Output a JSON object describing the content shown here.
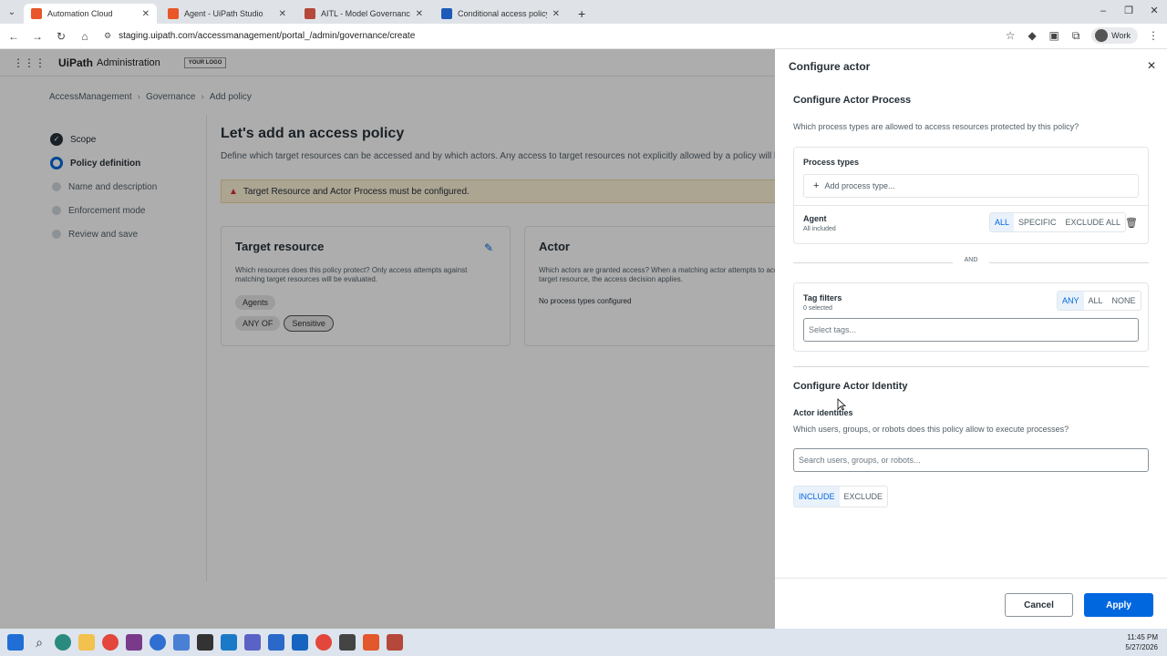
{
  "browser": {
    "tabs": [
      {
        "title": "Automation Cloud",
        "color": "#e8562a",
        "active": true
      },
      {
        "title": "Agent - UiPath Studio",
        "color": "#e8562a",
        "active": false
      },
      {
        "title": "AITL - Model Governance - De",
        "color": "#b5483a",
        "active": false
      },
      {
        "title": "Conditional access policy - Clo",
        "color": "#1e5bb8",
        "active": false
      }
    ],
    "url": "staging.uipath.com/accessmanagement/portal_/admin/governance/create",
    "profile": "Work"
  },
  "app": {
    "brand": "UiPath",
    "brand_sub": "Administration",
    "logo_placeholder": "YOUR LOGO"
  },
  "breadcrumb": [
    "AccessManagement",
    "Governance",
    "Add policy"
  ],
  "steps": [
    {
      "label": "Scope",
      "state": "done"
    },
    {
      "label": "Policy definition",
      "state": "current"
    },
    {
      "label": "Name and description",
      "state": "todo"
    },
    {
      "label": "Enforcement mode",
      "state": "todo"
    },
    {
      "label": "Review and save",
      "state": "todo"
    }
  ],
  "main": {
    "title": "Let's add an access policy",
    "description": "Define which target resources can be accessed and by which actors. Any access to target resources not explicitly allowed by a policy will be denied or",
    "warning": "Target Resource and Actor Process must be configured.",
    "target_card": {
      "title": "Target resource",
      "description": "Which resources does this policy protect? Only access attempts against matching target resources will be evaluated.",
      "chip_type": "Agents",
      "chip_operator": "ANY OF",
      "chip_tag": "Sensitive"
    },
    "actor_card": {
      "title": "Actor",
      "description": "Which actors are granted access? When a matching actor attempts to acc target resource, the access decision applies.",
      "empty": "No process types configured"
    }
  },
  "panel": {
    "title": "Configure actor",
    "process_section": {
      "title": "Configure Actor Process",
      "description": "Which process types are allowed to access resources protected by this policy?",
      "process_types_label": "Process types",
      "add_placeholder": "Add process type...",
      "agent_label": "Agent",
      "agent_sub": "All included",
      "agent_modes": [
        "ALL",
        "SPECIFIC",
        "EXCLUDE ALL"
      ],
      "agent_mode_selected": "ALL"
    },
    "and_label": "AND",
    "tags": {
      "label": "Tag filters",
      "sub": "0 selected",
      "modes": [
        "ANY",
        "ALL",
        "NONE"
      ],
      "mode_selected": "ANY",
      "placeholder": "Select tags..."
    },
    "identity_section": {
      "title": "Configure Actor Identity",
      "label": "Actor identities",
      "description": "Which users, groups, or robots does this policy allow to execute processes?",
      "search_placeholder": "Search users, groups, or robots...",
      "modes": [
        "INCLUDE",
        "EXCLUDE"
      ],
      "mode_selected": "INCLUDE"
    },
    "cancel_label": "Cancel",
    "apply_label": "Apply",
    "accent_color": "#0067df"
  },
  "taskbar": {
    "time": "11:45 PM",
    "date": "5/27/2026"
  }
}
